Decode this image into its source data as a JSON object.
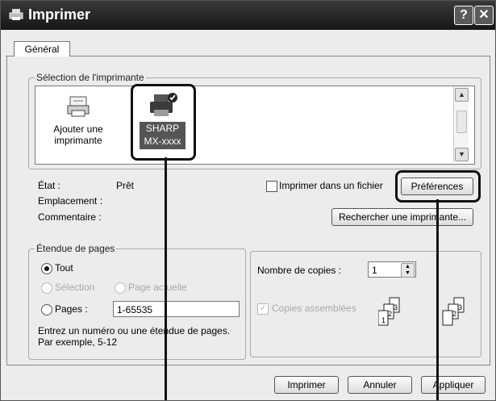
{
  "window": {
    "title": "Imprimer",
    "help_glyph": "?",
    "close_glyph": "✕"
  },
  "tabs": [
    {
      "label": "Général"
    }
  ],
  "printer_select": {
    "legend": "Sélection de l'imprimante",
    "add_printer": {
      "line1": "Ajouter une",
      "line2": "imprimante"
    },
    "selected_printer": {
      "line1": "SHARP",
      "line2": "MX-xxxx"
    }
  },
  "status": {
    "state_label": "État :",
    "state_value": "Prêt",
    "location_label": "Emplacement :",
    "comment_label": "Commentaire :",
    "print_to_file_label": "Imprimer dans un fichier",
    "preferences_label": "Préférences",
    "find_printer_label": "Rechercher une imprimante..."
  },
  "page_range": {
    "legend": "Étendue de pages",
    "all_label": "Tout",
    "selection_label": "Sélection",
    "current_page_label": "Page actuelle",
    "pages_label": "Pages :",
    "pages_value": "1-65535",
    "hint_line1": "Entrez un numéro ou une étendue de pages.",
    "hint_line2": "Par exemple, 5-12"
  },
  "copies": {
    "count_label": "Nombre de copies :",
    "count_value": "1",
    "collate_label": "Copies assemblées",
    "collate_icons": [
      "1",
      "2",
      "3"
    ]
  },
  "footer": {
    "print_label": "Imprimer",
    "cancel_label": "Annuler",
    "apply_label": "Appliquer"
  }
}
